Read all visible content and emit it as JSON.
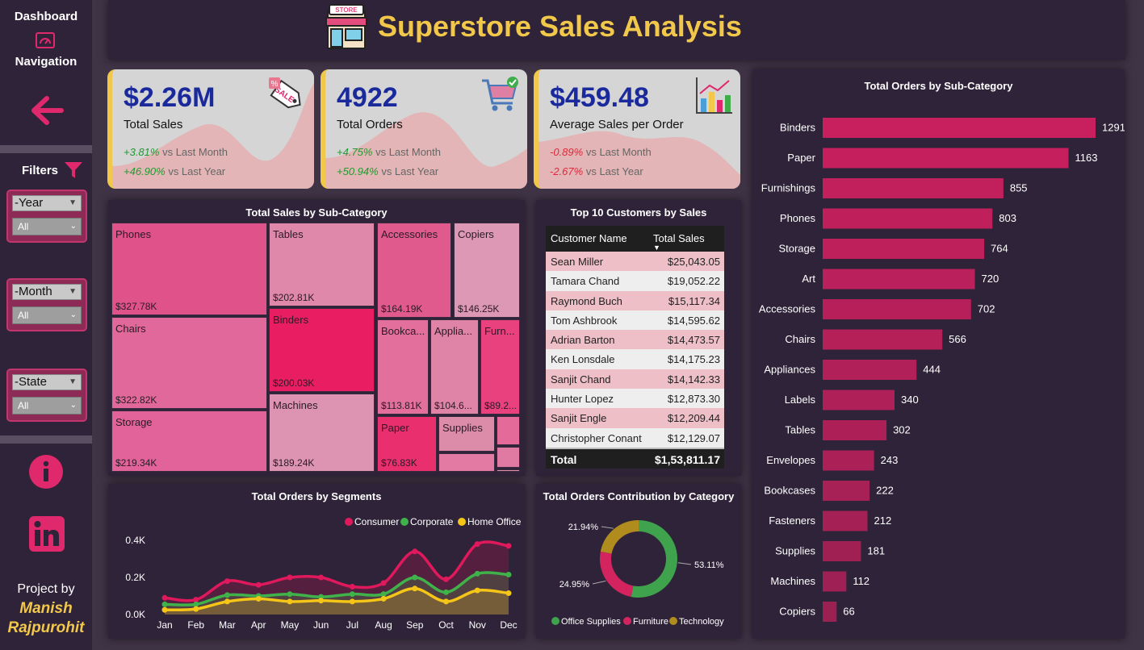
{
  "sidebar": {
    "title_line1": "Dashboard",
    "title_line2": "Navigation",
    "filters_label": "Filters",
    "filters": [
      {
        "label": "-Year",
        "value": "All"
      },
      {
        "label": "-Month",
        "value": "All"
      },
      {
        "label": "-State",
        "value": "All"
      }
    ],
    "project_by": "Project by",
    "author_first": "Manish",
    "author_last": "Rajpurohit"
  },
  "header": {
    "store_sign": "STORE",
    "title": "Superstore Sales Analysis"
  },
  "kpis": [
    {
      "value": "$2.26M",
      "label": "Total Sales",
      "m_change": "+3.81%",
      "m_text": "vs Last Month",
      "y_change": "+46.90%",
      "y_text": "vs Last Year",
      "direction": "positive",
      "icon": "sale-tag-icon"
    },
    {
      "value": "4922",
      "label": "Total Orders",
      "m_change": "+4.75%",
      "m_text": "vs Last Month",
      "y_change": "+50.94%",
      "y_text": "vs Last Year",
      "direction": "positive",
      "icon": "shopping-cart-icon"
    },
    {
      "value": "$459.48",
      "label": "Average Sales per Order",
      "m_change": "-0.89%",
      "m_text": "vs Last Month",
      "y_change": "-2.67%",
      "y_text": "vs Last Year",
      "direction": "negative",
      "icon": "bar-chart-icon"
    }
  ],
  "treemap": {
    "title": "Total Sales by Sub-Category",
    "tiles": [
      {
        "name": "Phones",
        "value": "$327.78K",
        "color": "#e0528a"
      },
      {
        "name": "Tables",
        "value": "$202.81K",
        "color": "#df88aa"
      },
      {
        "name": "Accessories",
        "value": "$164.19K",
        "color": "#e05a8e"
      },
      {
        "name": "Copiers",
        "value": "$146.25K",
        "color": "#dc98b4"
      },
      {
        "name": "Chairs",
        "value": "$322.82K",
        "color": "#e0689a"
      },
      {
        "name": "Binders",
        "value": "$200.03K",
        "color": "#e91e62"
      },
      {
        "name": "Bookca...",
        "value": "$113.81K",
        "color": "#e36f9c"
      },
      {
        "name": "Applia...",
        "value": "$104.6...",
        "color": "#df84a6"
      },
      {
        "name": "Furn...",
        "value": "$89.2...",
        "color": "#e8417e"
      },
      {
        "name": "Storage",
        "value": "$219.34K",
        "color": "#e2639a"
      },
      {
        "name": "Machines",
        "value": "$189.24K",
        "color": "#dc94b2"
      },
      {
        "name": "Paper",
        "value": "$76.83K",
        "color": "#ea2f6f"
      },
      {
        "name": "Supplies",
        "value": "",
        "color": "#dc8ca8"
      },
      {
        "name": "",
        "value": "",
        "color": "#e46a99"
      },
      {
        "name": "",
        "value": "",
        "color": "#e07aa2"
      },
      {
        "name": "",
        "value": "",
        "color": "#e27aa4"
      },
      {
        "name": "",
        "value": "",
        "color": "#dd8fac"
      }
    ]
  },
  "customers": {
    "title": "Top 10 Customers by Sales",
    "col_name": "Customer Name",
    "col_sales": "Total Sales",
    "rows": [
      {
        "name": "Sean Miller",
        "sales": "$25,043.05"
      },
      {
        "name": "Tamara Chand",
        "sales": "$19,052.22"
      },
      {
        "name": "Raymond Buch",
        "sales": "$15,117.34"
      },
      {
        "name": "Tom Ashbrook",
        "sales": "$14,595.62"
      },
      {
        "name": "Adrian Barton",
        "sales": "$14,473.57"
      },
      {
        "name": "Ken Lonsdale",
        "sales": "$14,175.23"
      },
      {
        "name": "Sanjit Chand",
        "sales": "$14,142.33"
      },
      {
        "name": "Hunter Lopez",
        "sales": "$12,873.30"
      },
      {
        "name": "Sanjit Engle",
        "sales": "$12,209.44"
      },
      {
        "name": "Christopher Conant",
        "sales": "$12,129.07"
      }
    ],
    "total_label": "Total",
    "total_value": "$1,53,811.17",
    "row_colors": [
      "#eebfc7",
      "#eeeeee"
    ]
  },
  "chart_data": [
    {
      "type": "bar",
      "title": "Total Orders by Sub-Category",
      "orientation": "horizontal",
      "categories": [
        "Binders",
        "Paper",
        "Furnishings",
        "Phones",
        "Storage",
        "Art",
        "Accessories",
        "Chairs",
        "Appliances",
        "Labels",
        "Tables",
        "Envelopes",
        "Bookcases",
        "Fasteners",
        "Supplies",
        "Machines",
        "Copiers"
      ],
      "values": [
        1291,
        1163,
        855,
        803,
        764,
        720,
        702,
        566,
        444,
        340,
        302,
        243,
        222,
        212,
        181,
        112,
        66
      ],
      "color": "#c8205e"
    },
    {
      "type": "line",
      "title": "Total Orders by Segments",
      "categories": [
        "Jan",
        "Feb",
        "Mar",
        "Apr",
        "May",
        "Jun",
        "Jul",
        "Aug",
        "Sep",
        "Oct",
        "Nov",
        "Dec"
      ],
      "yticks": [
        "0.0K",
        "0.2K",
        "0.4K"
      ],
      "ylim": [
        0,
        400
      ],
      "legend": "top-right",
      "series": [
        {
          "name": "Consumer",
          "color": "#e0195c",
          "values": [
            90,
            80,
            180,
            160,
            200,
            200,
            150,
            170,
            340,
            190,
            380,
            370
          ]
        },
        {
          "name": "Corporate",
          "color": "#3fb24a",
          "values": [
            55,
            55,
            105,
            100,
            110,
            95,
            110,
            110,
            200,
            120,
            220,
            215
          ]
        },
        {
          "name": "Home Office",
          "color": "#f5c518",
          "values": [
            25,
            30,
            70,
            85,
            70,
            75,
            70,
            85,
            140,
            70,
            130,
            115
          ]
        }
      ]
    },
    {
      "type": "pie",
      "subtype": "donut",
      "title": "Total Orders Contribution by Category",
      "legend": "bottom",
      "slices": [
        {
          "name": "Office Supplies",
          "value": 53.11,
          "label": "53.11%",
          "color": "#3fa34d"
        },
        {
          "name": "Furniture",
          "value": 24.95,
          "label": "24.95%",
          "color": "#d4245f"
        },
        {
          "name": "Technology",
          "value": 21.94,
          "label": "21.94%",
          "color": "#b08c1e"
        }
      ]
    }
  ]
}
